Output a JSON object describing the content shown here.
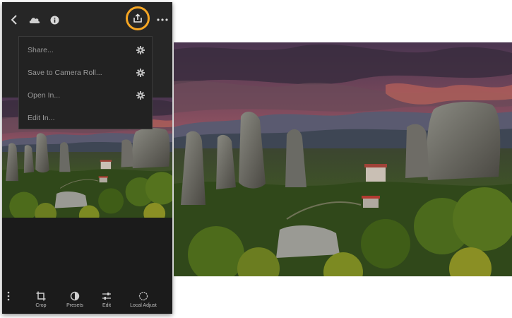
{
  "toolbar": {
    "icons": [
      "back-chevron-icon",
      "cloud-icon",
      "info-icon",
      "share-icon",
      "more-dots-icon"
    ],
    "highlight_color": "#f6a623"
  },
  "export_menu": {
    "items": [
      {
        "label": "Share..."
      },
      {
        "label": "Save to Camera Roll..."
      },
      {
        "label": "Open In..."
      },
      {
        "label": "Edit In..."
      }
    ]
  },
  "bottom_bar": {
    "tools": [
      {
        "label": "Crop",
        "icon": "crop-icon"
      },
      {
        "label": "Presets",
        "icon": "presets-icon"
      },
      {
        "label": "Edit",
        "icon": "sliders-icon"
      },
      {
        "label": "Local Adjust",
        "icon": "local-adjust-icon"
      }
    ]
  }
}
